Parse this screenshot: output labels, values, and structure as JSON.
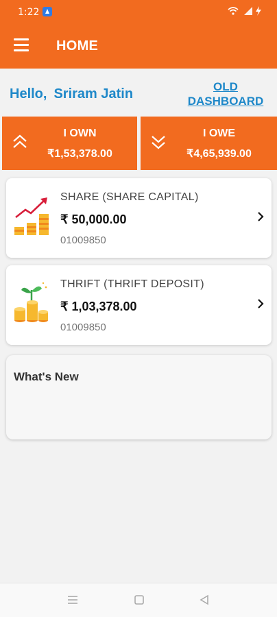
{
  "status": {
    "time": "1:22"
  },
  "appbar": {
    "title": "HOME"
  },
  "greeting": {
    "hello": "Hello,",
    "name": "Sriram Jatin"
  },
  "old_dashboard": {
    "label": "OLD DASHBOARD"
  },
  "summary": {
    "own": {
      "label": "I OWN",
      "amount": "₹1,53,378.00"
    },
    "owe": {
      "label": "I OWE",
      "amount": "₹4,65,939.00"
    }
  },
  "accounts": [
    {
      "title": "SHARE  (SHARE CAPITAL)",
      "amount": "₹ 50,000.00",
      "number": "01009850",
      "icon": "growth-chart-icon"
    },
    {
      "title": "THRIFT  (THRIFT DEPOSIT)",
      "amount": "₹ 1,03,378.00",
      "number": "01009850",
      "icon": "plant-coins-icon"
    }
  ],
  "whats_new": {
    "title": "What's New"
  },
  "colors": {
    "primary": "#f26b1f",
    "link": "#1e88c9",
    "coin": "#f6b82e"
  }
}
